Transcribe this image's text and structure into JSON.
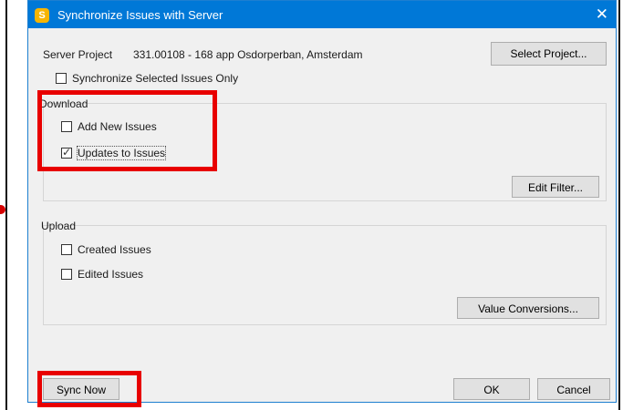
{
  "dialog": {
    "title": "Synchronize Issues with Server",
    "app_icon_letter": "S",
    "close_glyph": "✕"
  },
  "server_project": {
    "label": "Server Project",
    "value": "331.00108 - 168 app Osdorperban, Amsterdam",
    "select_button": "Select Project..."
  },
  "sync_selected_only": {
    "label": "Synchronize Selected Issues Only",
    "checked": false
  },
  "download": {
    "title": "Download",
    "add_new": {
      "label": "Add New Issues",
      "checked": false
    },
    "updates": {
      "label": "Updates to Issues",
      "checked": true
    },
    "filter_button": "Edit Filter..."
  },
  "upload": {
    "title": "Upload",
    "created": {
      "label": "Created Issues",
      "checked": false
    },
    "edited": {
      "label": "Edited Issues",
      "checked": false
    },
    "conversions_button": "Value Conversions..."
  },
  "footer": {
    "sync_now": "Sync Now",
    "ok": "OK",
    "cancel": "Cancel"
  },
  "colors": {
    "titlebar": "#0078d7",
    "highlight": "#e80000",
    "dialog_bg": "#f0f0f0"
  },
  "icons": [
    "app-icon",
    "close-icon",
    "checkbox-icon"
  ]
}
